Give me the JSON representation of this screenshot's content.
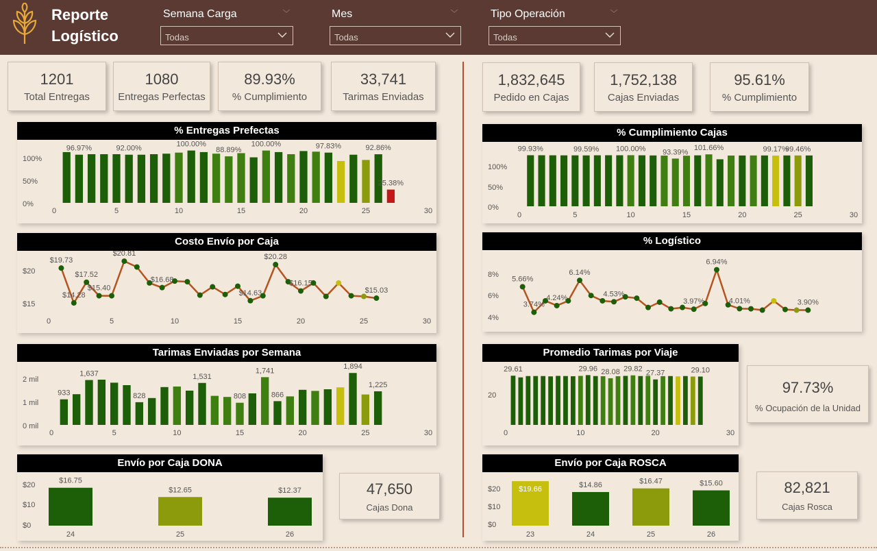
{
  "header": {
    "title_line1": "Reporte",
    "title_line2": "Logístico",
    "filters": [
      {
        "label": "Semana Carga",
        "value": "Todas"
      },
      {
        "label": "Mes",
        "value": "Todas"
      },
      {
        "label": "Tipo Operación",
        "value": "Todas"
      }
    ]
  },
  "kpis_left": [
    {
      "value": "1201",
      "label": "Total Entregas"
    },
    {
      "value": "1080",
      "label": "Entregas Perfectas"
    },
    {
      "value": "89.93%",
      "label": "% Cumplimiento"
    },
    {
      "value": "33,741",
      "label": "Tarimas Enviadas"
    }
  ],
  "kpis_right": [
    {
      "value": "1,832,645",
      "label": "Pedido en Cajas"
    },
    {
      "value": "1,752,138",
      "label": "Cajas Enviadas"
    },
    {
      "value": "95.61%",
      "label": "% Cumplimiento"
    }
  ],
  "side_cards": {
    "ocupacion": {
      "value": "97.73%",
      "label": "% Ocupación de la Unidad"
    },
    "cajas_dona": {
      "value": "47,650",
      "label": "Cajas Dona"
    },
    "cajas_rosca": {
      "value": "82,821",
      "label": "Cajas Rosca"
    }
  },
  "colors": {
    "dark_green": "#1d5e08",
    "mid_green": "#3f7f12",
    "olive": "#8c9b0c",
    "yellow": "#c7bf0e",
    "red": "#c21818",
    "line": "#b5541e",
    "header_bg": "#5a3a32"
  },
  "chart_data": [
    {
      "id": "entregas",
      "type": "bar",
      "title": "% Entregas Prefectas",
      "x": [
        1,
        2,
        3,
        4,
        5,
        6,
        7,
        8,
        9,
        10,
        11,
        12,
        13,
        14,
        15,
        16,
        17,
        18,
        19,
        20,
        21,
        22,
        23,
        24,
        25,
        26
      ],
      "values": [
        96.97,
        92,
        93,
        93,
        93,
        92,
        92,
        93,
        94,
        96,
        100,
        97,
        94,
        88.89,
        95,
        87,
        100,
        97,
        93,
        99,
        97.83,
        96,
        80,
        92,
        82,
        92.86
      ],
      "extra_points": [
        {
          "x": 27,
          "value": 25.38
        }
      ],
      "data_labels": {
        "2": "96.97%",
        "6": "92.00%",
        "11": "100.00%",
        "14": "88.89%",
        "17": "100.00%",
        "22": "97.83%",
        "26": "92.86%"
      },
      "extra_label": "25.38%",
      "yticks": [
        "100%",
        "50%",
        "0%"
      ],
      "xticks": [
        "0",
        "5",
        "10",
        "15",
        "20",
        "25",
        "30"
      ],
      "ylim": [
        0,
        110
      ],
      "xlim": [
        0,
        30
      ]
    },
    {
      "id": "costo",
      "type": "line",
      "title": "Costo Envío por Caja",
      "x": [
        1,
        2,
        3,
        4,
        5,
        6,
        7,
        8,
        9,
        10,
        11,
        12,
        13,
        14,
        15,
        16,
        17,
        18,
        19,
        20,
        21,
        22,
        23,
        24,
        25,
        26
      ],
      "values": [
        19.73,
        14.28,
        17.52,
        15.4,
        15.4,
        20.81,
        19.9,
        17.4,
        16.68,
        17.7,
        17.6,
        15.5,
        16.8,
        15.6,
        16.9,
        14.63,
        15.4,
        20.28,
        17.6,
        16.15,
        17.4,
        15.3,
        17.4,
        15.4,
        15.3,
        15.03
      ],
      "data_labels": {
        "1": "$19.73",
        "2": "$14.28",
        "3": "$17.52",
        "4": "$15.40",
        "6": "$20.81",
        "9": "$16.68",
        "16": "$14.63",
        "18": "$20.28",
        "20": "$16.15",
        "26": "$15.03"
      },
      "yticks": [
        "$20",
        "$15"
      ],
      "xticks": [
        "0",
        "5",
        "10",
        "15",
        "20",
        "25",
        "30"
      ],
      "ylim": [
        13,
        22
      ],
      "xlim": [
        0,
        30
      ]
    },
    {
      "id": "tarimas",
      "type": "bar",
      "title": "Tarimas Enviadas por Semana",
      "x": [
        1,
        2,
        3,
        4,
        5,
        6,
        7,
        8,
        9,
        10,
        11,
        12,
        13,
        14,
        15,
        16,
        17,
        18,
        19,
        20,
        21,
        22,
        23,
        24,
        25,
        26
      ],
      "values": [
        933,
        1120,
        1637,
        1650,
        1540,
        1450,
        828,
        980,
        1380,
        1400,
        1250,
        1531,
        1060,
        1020,
        808,
        1150,
        1741,
        866,
        1040,
        1280,
        1240,
        1300,
        1370,
        1894,
        1110,
        1225
      ],
      "data_labels": {
        "1": "933",
        "3": "1,637",
        "7": "828",
        "12": "1,531",
        "15": "808",
        "17": "1,741",
        "18": "866",
        "24": "1,894",
        "26": "1,225"
      },
      "yticks": [
        "2 mil",
        "1 mil",
        "0 mil"
      ],
      "xticks": [
        "0",
        "5",
        "10",
        "15",
        "20",
        "25",
        "30"
      ],
      "ylim": [
        0,
        2200
      ],
      "xlim": [
        0,
        30
      ]
    },
    {
      "id": "dona",
      "type": "bar",
      "title": "Envío por Caja DONA",
      "categories": [
        "24",
        "25",
        "26"
      ],
      "values": [
        16.75,
        12.65,
        12.37
      ],
      "data_labels": [
        "$16.75",
        "$12.65",
        "$12.37"
      ],
      "yticks": [
        "$20",
        "$10",
        "$0"
      ],
      "ylim": [
        0,
        20
      ]
    },
    {
      "id": "cumplimiento",
      "type": "bar",
      "title": "% Cumplimiento Cajas",
      "x": [
        1,
        2,
        3,
        4,
        5,
        6,
        7,
        8,
        9,
        10,
        11,
        12,
        13,
        14,
        15,
        16,
        17,
        18,
        19,
        20,
        21,
        22,
        23,
        24,
        25,
        26
      ],
      "values": [
        99.93,
        99.9,
        99.8,
        99.7,
        99.7,
        99.59,
        99.8,
        99.9,
        99.9,
        100,
        99.8,
        99.5,
        99.2,
        93.39,
        99,
        99.7,
        101.66,
        92,
        99.3,
        99.4,
        99.5,
        99.5,
        99.17,
        99.5,
        99.46,
        99.46
      ],
      "data_labels": {
        "1": "99.93%",
        "6": "99.59%",
        "10": "100.00%",
        "14": "93.39%",
        "17": "101.66%",
        "23": "99.17%",
        "25": "99.46%"
      },
      "yticks": [
        "100%",
        "50%",
        "0%"
      ],
      "xticks": [
        "0",
        "5",
        "10",
        "15",
        "20",
        "25",
        "30"
      ],
      "ylim": [
        0,
        110
      ],
      "xlim": [
        0,
        30
      ]
    },
    {
      "id": "logistico",
      "type": "line",
      "title": "% Logístico",
      "x": [
        1,
        2,
        3,
        4,
        5,
        6,
        7,
        8,
        9,
        10,
        11,
        12,
        13,
        14,
        15,
        16,
        17,
        18,
        19,
        20,
        21,
        22,
        23,
        24,
        25,
        26
      ],
      "values": [
        5.66,
        3.74,
        4.6,
        4.24,
        4.6,
        6.14,
        5.0,
        4.6,
        4.53,
        4.9,
        4.8,
        4.1,
        4.5,
        4.0,
        4.1,
        3.97,
        4.4,
        6.94,
        4.3,
        4.01,
        4.0,
        3.9,
        4.6,
        3.95,
        3.9,
        3.9
      ],
      "data_labels": {
        "1": "5.66%",
        "2": "3.74%",
        "4": "4.24%",
        "6": "6.14%",
        "9": "4.53%",
        "16": "3.97%",
        "18": "6.94%",
        "20": "4.01%",
        "26": "3.90%"
      },
      "yticks": [
        "8%",
        "6%",
        "4%"
      ],
      "xticks": [
        "0",
        "5",
        "10",
        "15",
        "20",
        "25",
        "30"
      ],
      "ylim": [
        3,
        8
      ],
      "xlim": [
        0,
        30
      ]
    },
    {
      "id": "promedio",
      "type": "bar",
      "title": "Promedio Tarimas por Viaje",
      "x": [
        1,
        2,
        3,
        4,
        5,
        6,
        7,
        8,
        9,
        10,
        11,
        12,
        13,
        14,
        15,
        16,
        17,
        18,
        19,
        20,
        21,
        22,
        23,
        24,
        25,
        26
      ],
      "values": [
        29.61,
        28.6,
        29.4,
        29.4,
        29.4,
        29.2,
        29.5,
        29.4,
        29.3,
        29.5,
        29.96,
        29.4,
        29.3,
        28.08,
        29.3,
        29.5,
        29.82,
        29.4,
        29.5,
        27.37,
        29.3,
        29.4,
        29.2,
        29.4,
        29.1,
        29.1
      ],
      "data_labels": {
        "1": "29.61",
        "11": "29.96",
        "14": "28.08",
        "17": "29.82",
        "20": "27.37",
        "26": "29.10"
      },
      "yticks": [
        "20"
      ],
      "xticks": [
        "0",
        "10",
        "20",
        "30"
      ],
      "ylim": [
        0,
        33
      ],
      "xlim": [
        0,
        30
      ]
    },
    {
      "id": "rosca",
      "type": "bar",
      "title": "Envío por Caja ROSCA",
      "categories": [
        "23",
        "24",
        "25",
        "26"
      ],
      "values": [
        19.66,
        14.86,
        16.47,
        15.6
      ],
      "data_labels": [
        "$19.66",
        "$14.86",
        "$16.47",
        "$15.60"
      ],
      "yticks": [
        "$20",
        "$10",
        "$0"
      ],
      "ylim": [
        0,
        20
      ]
    }
  ]
}
